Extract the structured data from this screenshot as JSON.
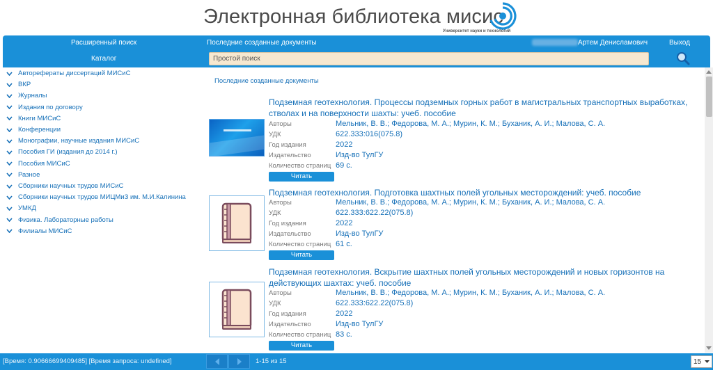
{
  "header": {
    "logo_text": "Электронная библиотека мисис",
    "logo_sub": "Университет науки и технологий"
  },
  "topbar": {
    "advanced_search": "Расширенный поиск",
    "recent_docs": "Последние созданные документы",
    "user_name": "Артем Денисламович",
    "logout": "Выход",
    "catalog": "Каталог",
    "search_placeholder": "Простой поиск"
  },
  "sidebar": {
    "items": [
      {
        "label": "Автореферaты диссертаций МИСиС"
      },
      {
        "label": "ВКР"
      },
      {
        "label": "Журналы"
      },
      {
        "label": "Издания по договору"
      },
      {
        "label": "Книги МИСиС"
      },
      {
        "label": "Конференции"
      },
      {
        "label": "Монографии, научные издания МИСиС"
      },
      {
        "label": "Пособия ГИ (издания до 2014 г.)"
      },
      {
        "label": "Пособия МИСиС"
      },
      {
        "label": "Разное"
      },
      {
        "label": "Сборники научных трудов МИСиС"
      },
      {
        "label": "Сборники научных трудов МИЦМиЗ им. М.И.Калинина"
      },
      {
        "label": "УМКД"
      },
      {
        "label": "Физика. Лабораторные работы"
      },
      {
        "label": "Филиалы МИСиС"
      }
    ]
  },
  "main": {
    "breadcrumb": "Последние созданные документы",
    "labels": {
      "authors": "Авторы",
      "udk": "УДК",
      "year": "Год издания",
      "publisher": "Издательство",
      "pages": "Количество страниц"
    },
    "read_label": "Читать",
    "docs": [
      {
        "title": "Подземная геотехнология. Процессы подземных горных работ в магистральных транспортных выработках, стволах и на поверхности шахты: учеб. пособие",
        "authors": "Мельник, В. В.; Федорова, М. А.; Мурин, К. М.; Буханик, А. И.; Малова, С. А.",
        "udk": "622.333:016(075.8)",
        "year": "2022",
        "publisher": "Изд-во ТулГУ",
        "pages": "69 с."
      },
      {
        "title": "Подземная геотехнология. Подготовка шахтных полей угольных месторождений: учеб. пособие",
        "authors": "Мельник, В. В.; Федорова, М. А.; Мурин, К. М.; Буханик, А. И.; Малова, С. А.",
        "udk": "622.333:622.22(075.8)",
        "year": "2022",
        "publisher": "Изд-во ТулГУ",
        "pages": "61 с."
      },
      {
        "title": "Подземная геотехнология. Вскрытие шахтных полей угольных месторождений и новых горизонтов на действующих шахтах: учеб. пособие",
        "authors": "Мельник, В. В.; Федорова, М. А.; Мурин, К. М.; Буханик, А. И.; Малова, С. А.",
        "udk": "622.333:622.22(075.8)",
        "year": "2022",
        "publisher": "Изд-во ТулГУ",
        "pages": "83 с."
      }
    ]
  },
  "footer": {
    "status": "[Время: 0.90666699409485] [Время запроса: undefined]",
    "pager_info": "1-15 из 15",
    "page_size": "15"
  },
  "colors": {
    "brand_blue": "#1a90d8",
    "link_blue": "#1670b8",
    "search_bg": "#f6e8d0"
  }
}
